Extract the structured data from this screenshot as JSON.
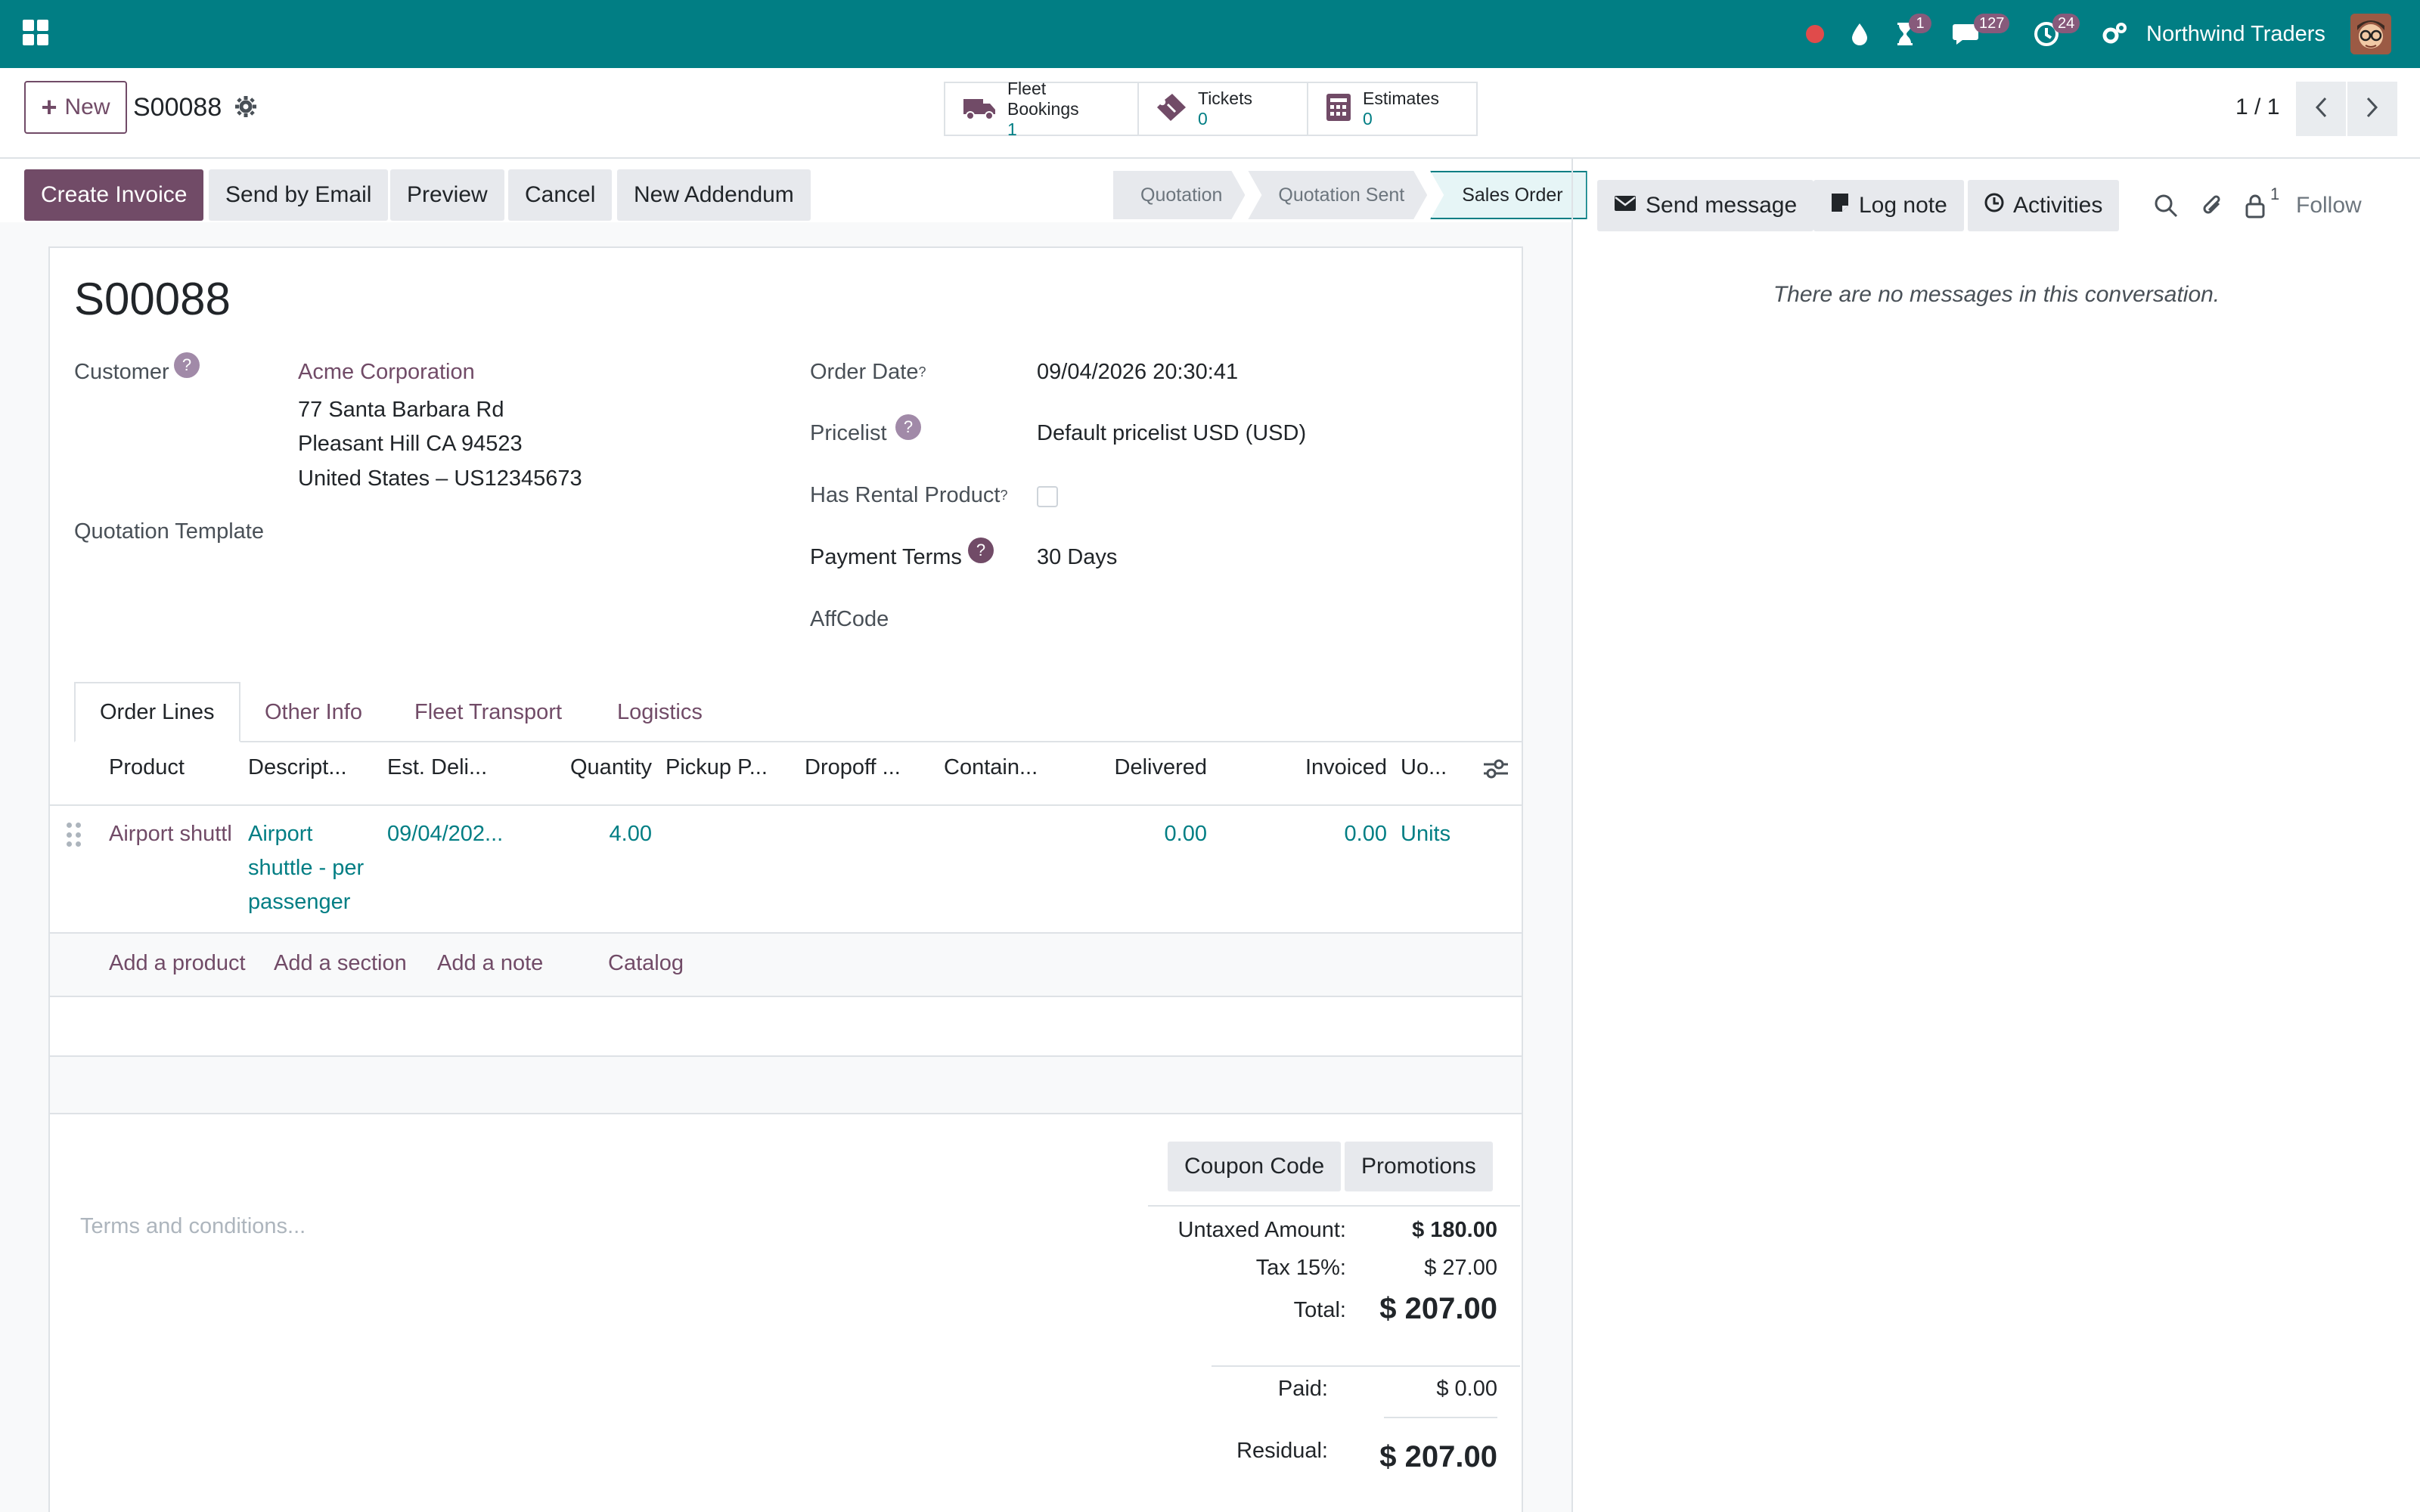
{
  "navbar": {
    "company": "Northwind Traders",
    "badges": {
      "activities": "1",
      "messages": "127",
      "clock": "24"
    },
    "accent": "#017e84"
  },
  "control": {
    "new_label": "New",
    "record_name": "S00088",
    "smart_buttons": [
      {
        "label": "Fleet Bookings",
        "value": "1",
        "icon": "truck-icon"
      },
      {
        "label": "Tickets",
        "value": "0",
        "icon": "ticket-icon"
      },
      {
        "label": "Estimates",
        "value": "0",
        "icon": "calculator-icon"
      }
    ],
    "pager": "1 / 1"
  },
  "actions": {
    "create_invoice": "Create Invoice",
    "send_by_email": "Send by Email",
    "preview": "Preview",
    "cancel": "Cancel",
    "new_addendum": "New Addendum"
  },
  "status": {
    "stages": [
      "Quotation",
      "Quotation Sent",
      "Sales Order"
    ],
    "active": "Sales Order"
  },
  "form": {
    "title": "S00088",
    "customer_label": "Customer",
    "customer_name": "Acme Corporation",
    "address_line1": "77 Santa Barbara Rd",
    "address_line2": "Pleasant Hill CA 94523",
    "address_line3": "United States – US12345673",
    "quotation_template_label": "Quotation Template",
    "order_date_label": "Order Date",
    "order_date": "09/04/2026 20:30:41",
    "pricelist_label": "Pricelist",
    "pricelist": "Default pricelist USD (USD)",
    "has_rental_label": "Has Rental Product",
    "has_rental": false,
    "payment_terms_label": "Payment Terms",
    "payment_terms": "30 Days",
    "affcode_label": "AffCode"
  },
  "tabs": [
    "Order Lines",
    "Other Info",
    "Fleet Transport",
    "Logistics"
  ],
  "lines": {
    "columns": [
      "Product",
      "Descript...",
      "Est. Deli...",
      "Quantity",
      "Pickup P...",
      "Dropoff ...",
      "Contain...",
      "Delivered",
      "Invoiced",
      "Uo..."
    ],
    "rows": [
      {
        "product": "Airport shuttl",
        "description_1": "Airport",
        "description_2": "shuttle - per",
        "description_3": "passenger",
        "est_delivery": "09/04/202...",
        "quantity": "4.00",
        "delivered": "0.00",
        "invoiced": "0.00",
        "uom": "Units"
      }
    ],
    "add_product": "Add a product",
    "add_section": "Add a section",
    "add_note": "Add a note",
    "catalog": "Catalog"
  },
  "footer": {
    "terms_placeholder": "Terms and conditions...",
    "coupon_code": "Coupon Code",
    "promotions": "Promotions",
    "untaxed_label": "Untaxed Amount:",
    "untaxed": "$ 180.00",
    "tax_label": "Tax 15%:",
    "tax": "$ 27.00",
    "total_label": "Total:",
    "total": "$ 207.00",
    "paid_label": "Paid:",
    "paid": "$ 0.00",
    "residual_label": "Residual:",
    "residual": "$ 207.00"
  },
  "chatter": {
    "send_message": "Send message",
    "log_note": "Log note",
    "activities": "Activities",
    "followers_count": "1",
    "follow": "Follow",
    "empty": "There are no messages in this conversation."
  }
}
